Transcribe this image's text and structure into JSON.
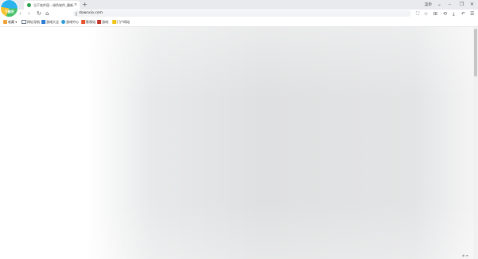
{
  "browser": {
    "logo_text": "下载吧",
    "tab": {
      "title": "当下软件园 - 绿色软件_最新最全",
      "close": "×"
    },
    "new_tab": "+",
    "window_label": "菜单",
    "window_controls": {
      "dropdown": "⌄",
      "minimize": "–",
      "restore": "❐",
      "close": "✕"
    }
  },
  "toolbar": {
    "back": "‹",
    "forward": "›",
    "reload": "↻",
    "home": "⌂",
    "url": "downxia.com",
    "icons": {
      "screenshot": "⛶",
      "favorite": "☆",
      "extensions": "⊞",
      "history": "⟲",
      "download": "⤓",
      "undo": "↶",
      "menu": "☰"
    }
  },
  "bookmarks": {
    "items": [
      {
        "label": "收藏",
        "color": "#f2a23a"
      },
      {
        "label": "网址导航",
        "color": "#6b7b8c"
      },
      {
        "label": "游戏大全",
        "color": "#2d7fd3"
      },
      {
        "label": "游戏中心",
        "color": "#2d9cdb"
      },
      {
        "label": "影视站",
        "color": "#e8542f"
      },
      {
        "label": "游戏",
        "color": "#c0392b"
      },
      {
        "label": "门户网站",
        "color": "#f0c419"
      }
    ]
  },
  "status": {
    "text": "⊕ ≡"
  },
  "colors": {
    "tabstrip": "#e8eaed",
    "accent": "#2a9d4a"
  }
}
